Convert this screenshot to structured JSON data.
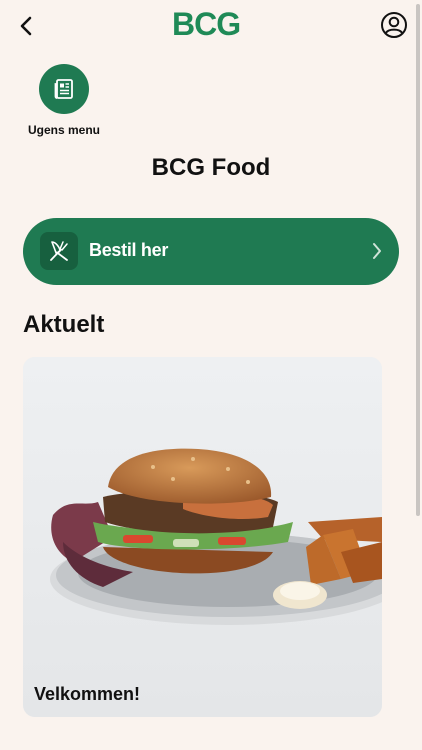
{
  "header": {
    "logo": "BCG",
    "back_icon": "chevron-left-icon",
    "profile_icon": "user-circle-icon"
  },
  "shortcut": {
    "label": "Ugens menu",
    "icon": "newspaper-icon"
  },
  "page": {
    "title": "BCG Food"
  },
  "order": {
    "label": "Bestil her",
    "icon": "cutlery-icon",
    "chevron_icon": "chevron-right-icon"
  },
  "news": {
    "title": "Aktuelt",
    "cards": [
      {
        "caption": "Velkommen!",
        "image": "burger-with-potato-wedges"
      }
    ]
  },
  "colors": {
    "background": "#faf3ee",
    "brand_green": "#1f7a52",
    "logo_green": "#1f8a57"
  }
}
